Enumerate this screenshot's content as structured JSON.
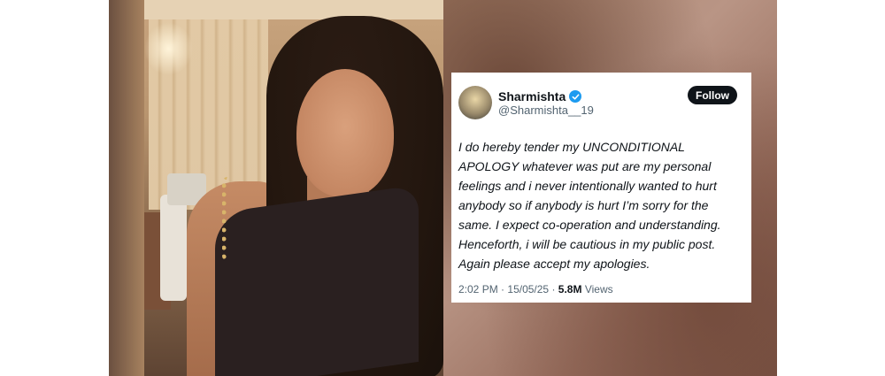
{
  "tweet": {
    "display_name": "Sharmishta",
    "handle": "@Sharmishta__19",
    "follow_label": "Follow",
    "verified_icon": "verified-check-icon",
    "text": "I do hereby tender my UNCONDITIONAL\nAPOLOGY whatever was put are my personal\nfeelings and i never intentionally wanted to hurt\nanybody so if anybody is hurt I’m sorry for the\nsame. I expect co-operation and understanding.\nHenceforth, i will be cautious in my public post.\nAgain please accept my apologies.",
    "time": "2:02 PM",
    "date": "15/05/25",
    "views_count": "5.8M",
    "views_label": "Views"
  },
  "colors": {
    "verified": "#1d9bf0",
    "follow_button": "#0f1419",
    "text_primary": "#0f1419",
    "text_secondary": "#536471"
  }
}
